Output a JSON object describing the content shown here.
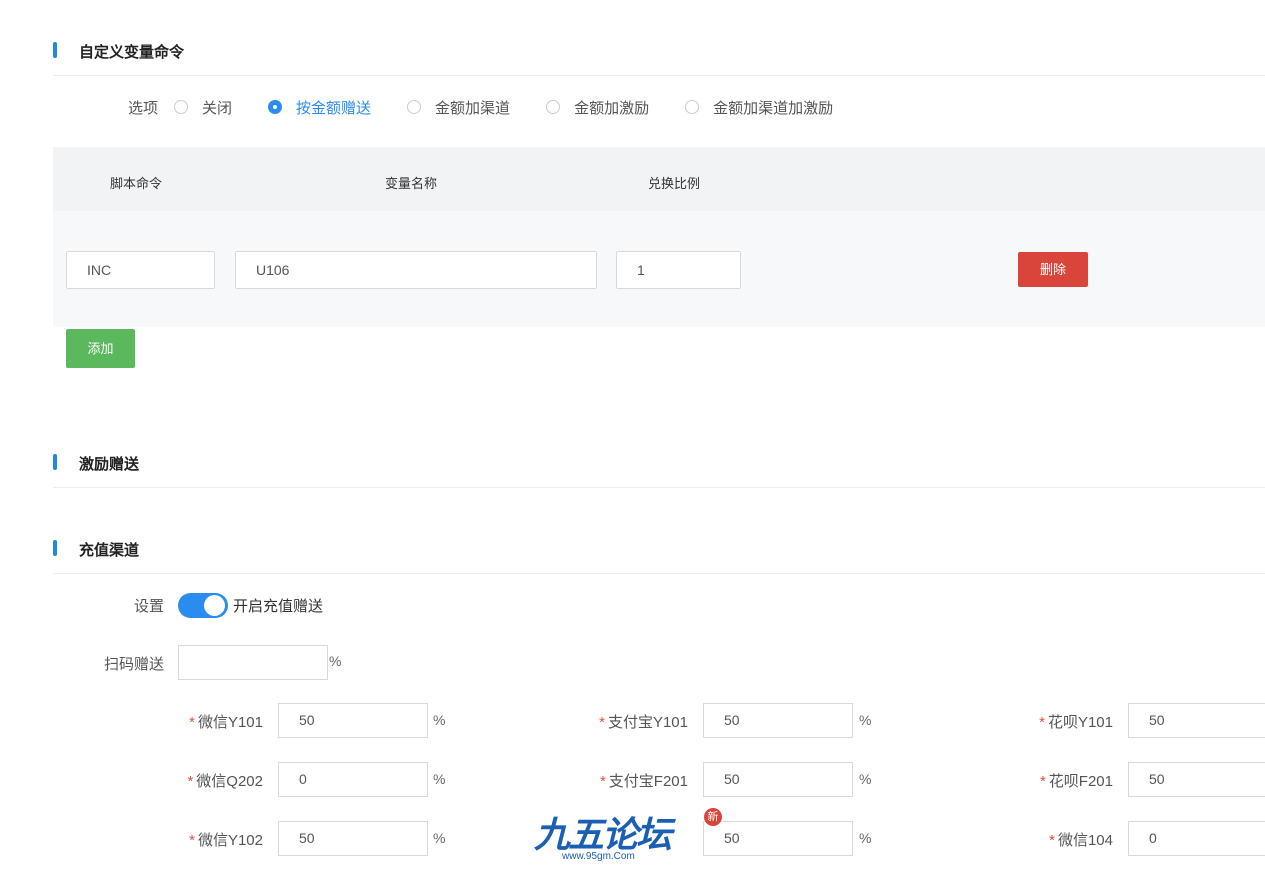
{
  "sections": {
    "custom_var": "自定义变量命令",
    "incentive": "激励赠送",
    "recharge": "充值渠道"
  },
  "options": {
    "label": "选项",
    "items": [
      "关闭",
      "按金额赠送",
      "金额加渠道",
      "金额加激励",
      "金额加渠道加激励"
    ],
    "selected": "按金额赠送"
  },
  "table": {
    "headers": [
      "脚本命令",
      "变量名称",
      "兑换比例"
    ],
    "row": {
      "command": "INC",
      "variable": "U106",
      "ratio": "1",
      "delete": "删除"
    },
    "add": "添加"
  },
  "recharge": {
    "setting_label": "设置",
    "toggle_on": true,
    "toggle_text": "开启充值赠送",
    "scan_label": "扫码赠送",
    "scan_value": "",
    "percent": "%",
    "fields": [
      {
        "label": "微信Y101",
        "value": "50",
        "required": true
      },
      {
        "label": "支付宝Y101",
        "value": "50",
        "required": true
      },
      {
        "label": "花呗Y101",
        "value": "50",
        "required": true
      },
      {
        "label": "微信Q202",
        "value": "0",
        "required": true
      },
      {
        "label": "支付宝F201",
        "value": "50",
        "required": true
      },
      {
        "label": "花呗F201",
        "value": "50",
        "required": true
      },
      {
        "label": "微信Y102",
        "value": "50",
        "required": true
      },
      {
        "label": "",
        "value": "50",
        "required": false
      },
      {
        "label": "微信104",
        "value": "0",
        "required": true
      }
    ]
  },
  "watermark": {
    "logo_text": "九五论坛",
    "url": "www.95gm.Com",
    "badge": "新"
  },
  "colors": {
    "accent": "#2b8cf0",
    "danger": "#d9453b",
    "success": "#5cb85c"
  }
}
